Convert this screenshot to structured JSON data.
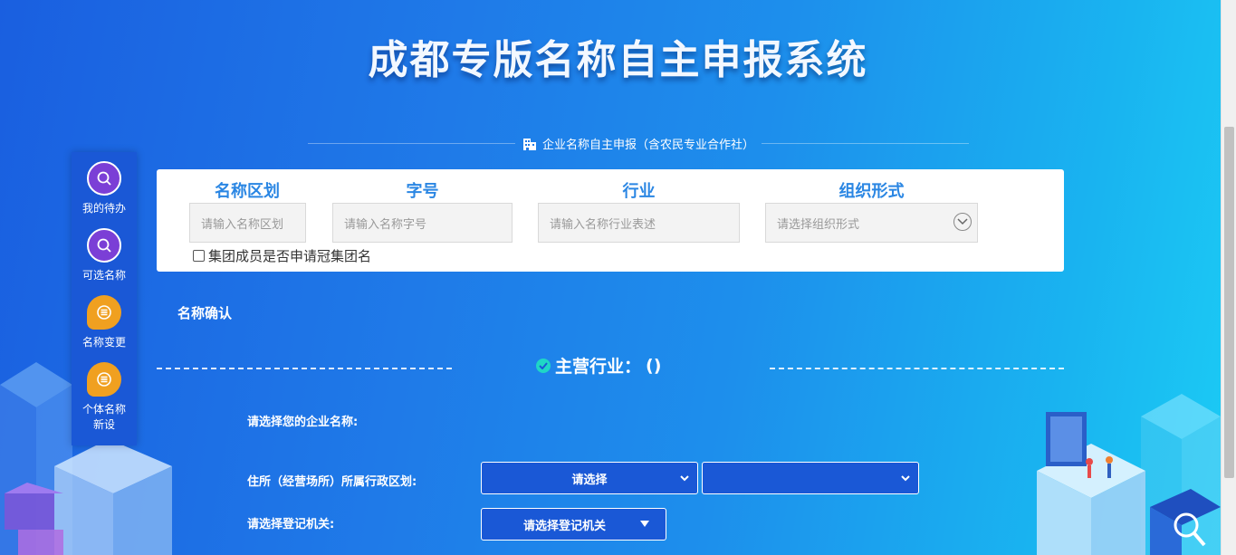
{
  "header": {
    "title": "成都专版名称自主申报系统",
    "subtitle": "企业名称自主申报（含农民专业合作社）"
  },
  "sidebar": {
    "items": [
      {
        "label": "我的待办",
        "icon": "search-icon",
        "color": "purple"
      },
      {
        "label": "可选名称",
        "icon": "search-icon",
        "color": "purple"
      },
      {
        "label": "名称变更",
        "icon": "list-icon",
        "color": "orange"
      },
      {
        "label": "个体名称新设",
        "icon": "list-icon",
        "color": "orange"
      }
    ]
  },
  "form": {
    "region": {
      "label": "名称区划",
      "placeholder": "请输入名称区划"
    },
    "trade_name": {
      "label": "字号",
      "placeholder": "请输入名称字号"
    },
    "industry": {
      "label": "行业",
      "placeholder": "请输入名称行业表述"
    },
    "org_form": {
      "label": "组织形式",
      "placeholder": "请选择组织形式"
    },
    "group_checkbox": {
      "label": "集团成员是否申请冠集团名",
      "checked": false
    }
  },
  "confirm": {
    "section_label": "名称确认",
    "main_industry_label": "主营行业：",
    "main_industry_value": "()",
    "choose_name_label": "请选择您的企业名称:",
    "district_label": "住所（经营场所）所属行政区划:",
    "district_select_1": "请选择",
    "district_select_2": "",
    "authority_label": "请选择登记机关:",
    "authority_select": "请选择登记机关"
  },
  "colors": {
    "accent_blue": "#2a86e3",
    "nav_bg": "#1a58d6",
    "purple": "#7b3fd6",
    "orange": "#f0a020",
    "check_teal": "#1fd6c6"
  }
}
